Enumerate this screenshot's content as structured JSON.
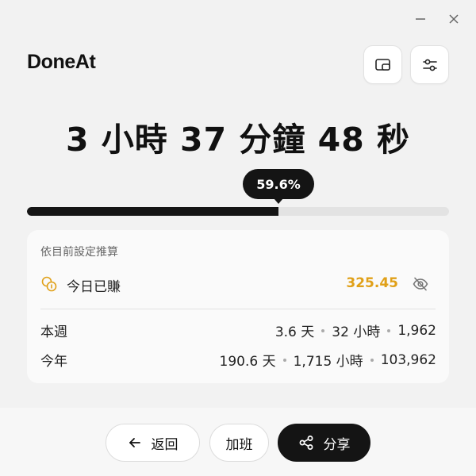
{
  "window": {
    "minimize_icon": "minimize-icon",
    "close_icon": "close-icon"
  },
  "app": {
    "title": "DoneAt"
  },
  "toolbar": {
    "pip_icon": "picture-in-picture-icon",
    "settings_icon": "sliders-icon"
  },
  "timer": {
    "text": "3 小時 37 分鐘 48 秒"
  },
  "progress": {
    "label": "59.6%",
    "value_percent": 59.6
  },
  "summary": {
    "caption": "依目前設定推算",
    "today": {
      "icon": "coins-icon",
      "label": "今日已賺",
      "value": "325.45",
      "visibility_icon": "eye-off-icon"
    },
    "week": {
      "label": "本週",
      "days": "3.6 天",
      "hours": "32 小時",
      "amount": "1,962"
    },
    "year": {
      "label": "今年",
      "days": "190.6 天",
      "hours": "1,715 小時",
      "amount": "103,962"
    }
  },
  "actions": {
    "back_label": "返回",
    "back_icon": "arrow-left-icon",
    "overtime_label": "加班",
    "share_label": "分享",
    "share_icon": "share-icon"
  },
  "colors": {
    "accent_gold": "#e0a018",
    "dark": "#141414",
    "background": "#f2f2f2"
  }
}
